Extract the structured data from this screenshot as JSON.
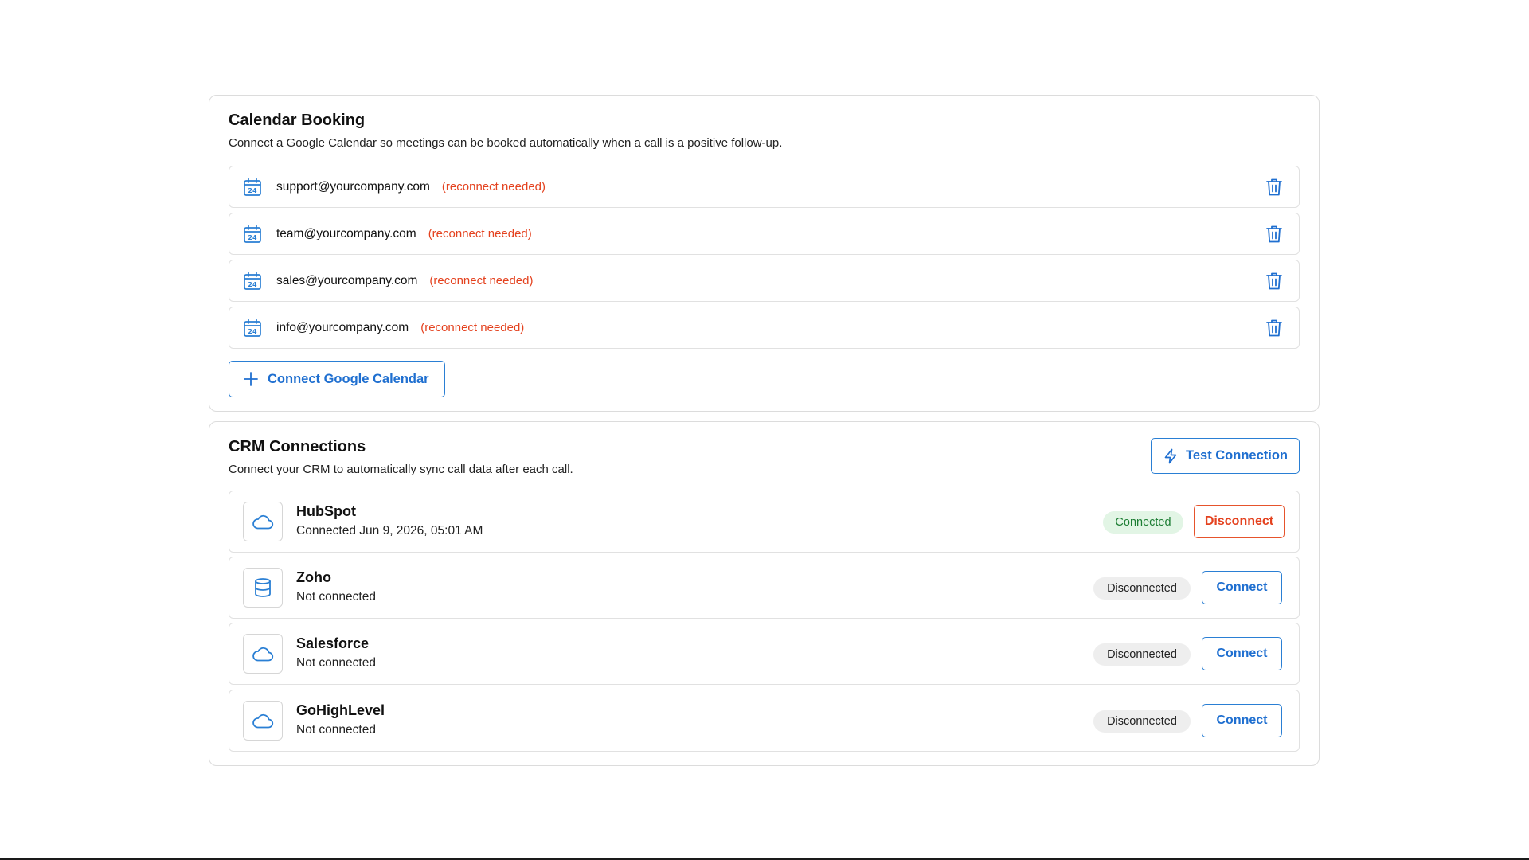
{
  "calendar": {
    "title": "Calendar Booking",
    "description": "Connect a Google Calendar so meetings can be booked automatically when a call is a positive follow-up.",
    "accounts": [
      {
        "email": "support@yourcompany.com",
        "status": "(reconnect needed)"
      },
      {
        "email": "team@yourcompany.com",
        "status": "(reconnect needed)"
      },
      {
        "email": "sales@yourcompany.com",
        "status": "(reconnect needed)"
      },
      {
        "email": "info@yourcompany.com",
        "status": "(reconnect needed)"
      }
    ],
    "connect_button": "Connect Google Calendar",
    "icons": {
      "account": "calendar-icon",
      "delete": "trash-icon",
      "add": "plus-icon"
    }
  },
  "crm": {
    "title": "CRM Connections",
    "description": "Connect your CRM to automatically sync call data after each call.",
    "test_button": "Test Connection",
    "test_icon": "bolt-icon",
    "providers": [
      {
        "name": "HubSpot",
        "subtitle": "Connected Jun 9, 2026, 05:01 AM",
        "status": "Connected",
        "action": "Disconnect",
        "icon": "cloud-icon"
      },
      {
        "name": "Zoho",
        "subtitle": "Not connected",
        "status": "Disconnected",
        "action": "Connect",
        "icon": "database-icon"
      },
      {
        "name": "Salesforce",
        "subtitle": "Not connected",
        "status": "Disconnected",
        "action": "Connect",
        "icon": "cloud-icon"
      },
      {
        "name": "GoHighLevel",
        "subtitle": "Not connected",
        "status": "Disconnected",
        "action": "Connect",
        "icon": "cloud-icon"
      }
    ]
  },
  "colors": {
    "accent": "#1f6fd0",
    "warning": "#e4421f",
    "success": "#1c7d33",
    "success_bg": "#e2f5e5",
    "neutral_bg": "#eeeeee"
  }
}
